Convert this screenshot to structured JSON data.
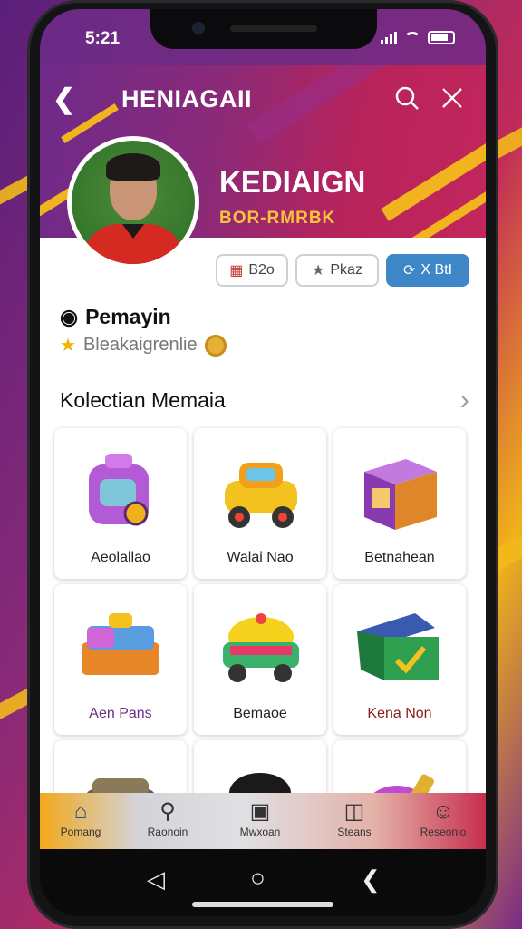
{
  "status": {
    "time": "5:21"
  },
  "header": {
    "title": "HENIAGAII",
    "profile_name": "KEDIAIGN",
    "profile_sub": "BOR-RMRBK"
  },
  "chips": [
    {
      "label": "B2o",
      "icon": "card-icon"
    },
    {
      "label": "Pkaz",
      "icon": "star-icon"
    },
    {
      "label": "X BtI",
      "icon": "refresh-icon"
    }
  ],
  "profile": {
    "section_title": "Pemayin",
    "section_sub": "Bleakaigrenlie"
  },
  "collection": {
    "title": "Kolectian Memaia",
    "items": [
      {
        "label": "Aeolallao"
      },
      {
        "label": "Walai Nao"
      },
      {
        "label": "Betnahean"
      },
      {
        "label": "Aen Pans"
      },
      {
        "label": "Bemaoe"
      },
      {
        "label": "Kena Non"
      },
      {
        "label": ""
      },
      {
        "label": ""
      },
      {
        "label": ""
      }
    ]
  },
  "nav": [
    {
      "label": "Pomang",
      "icon": "home-icon"
    },
    {
      "label": "Raonoin",
      "icon": "search-icon"
    },
    {
      "label": "Mwxoan",
      "icon": "camera-icon"
    },
    {
      "label": "Steans",
      "icon": "book-icon"
    },
    {
      "label": "Reseonio",
      "icon": "user-icon"
    }
  ],
  "colors": {
    "accent_purple": "#6d2a8a",
    "accent_red": "#c2265c",
    "accent_gold": "#f2b41e",
    "chip_blue": "#3d87c9"
  }
}
